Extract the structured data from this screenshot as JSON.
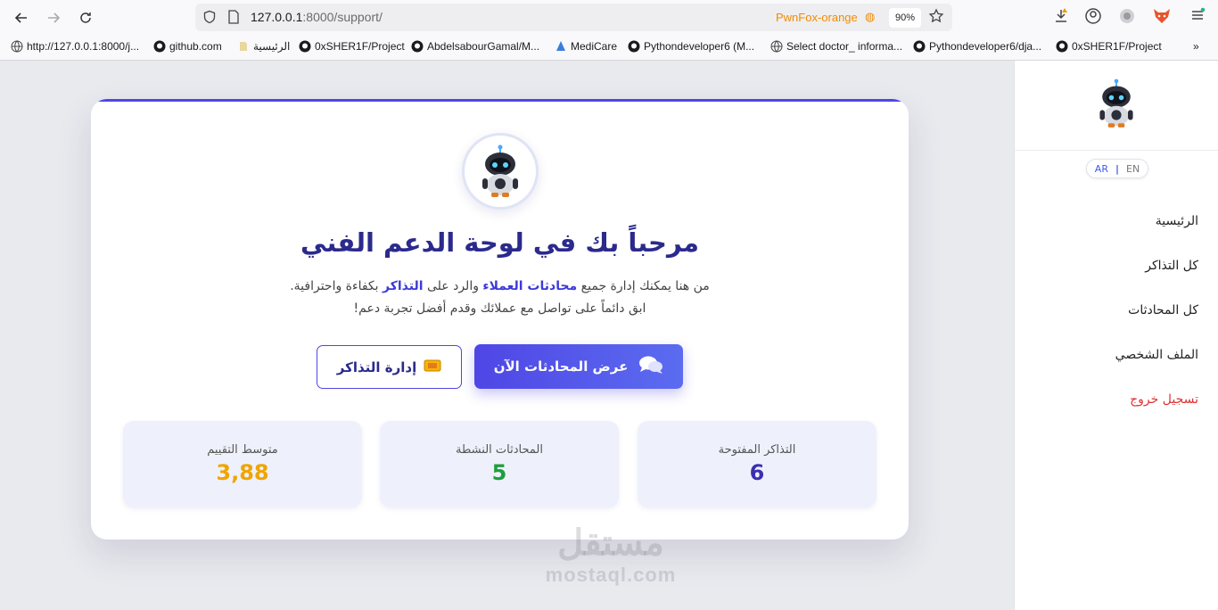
{
  "browser": {
    "url_host": "127.0.0.1",
    "url_rest": ":8000/support/",
    "container_label": "PwnFox-orange",
    "zoom": "90%",
    "bookmarks": [
      {
        "label": "http://127.0.0.1:8000/j...",
        "icon": "globe-icon"
      },
      {
        "label": "github.com",
        "icon": "github-icon"
      },
      {
        "label": "الرئيسية",
        "icon": "page-icon"
      },
      {
        "label": "0xSHER1F/Project",
        "icon": "github-icon"
      },
      {
        "label": "AbdelsabourGamal/M...",
        "icon": "github-icon"
      },
      {
        "label": "MediCare",
        "icon": "medicare-icon"
      },
      {
        "label": "Pythondeveloper6 (M...",
        "icon": "github-icon"
      },
      {
        "label": "Select doctor_ informa...",
        "icon": "globe-icon"
      },
      {
        "label": "Pythondeveloper6/dja...",
        "icon": "github-icon"
      },
      {
        "label": "0xSHER1F/Project",
        "icon": "github-icon"
      }
    ]
  },
  "sidebar": {
    "lang_ar": "AR",
    "lang_sep": "|",
    "lang_en": "EN",
    "items": [
      {
        "label": "الرئيسية"
      },
      {
        "label": "كل التذاكر"
      },
      {
        "label": "كل المحادثات"
      },
      {
        "label": "الملف الشخصي"
      },
      {
        "label": "تسجيل خروج"
      }
    ]
  },
  "main": {
    "title": "مرحباً بك في لوحة الدعم الفني",
    "subtitle_line1_a": "من هنا يمكنك إدارة جميع ",
    "subtitle_line1_hl1": "محادثات العملاء",
    "subtitle_line1_b": " والرد على ",
    "subtitle_line1_hl2": "التذاكر",
    "subtitle_line1_c": " بكفاءة واحترافية.",
    "subtitle_line2": "ابق دائماً على تواصل مع عملائك وقدم أفضل تجربة دعم!",
    "btn_chats": "عرض المحادثات الآن",
    "btn_tickets": "إدارة التذاكر",
    "stats": [
      {
        "label": "التذاكر المفتوحة",
        "value": "6",
        "color": "#3b2fb0"
      },
      {
        "label": "المحادثات النشطة",
        "value": "5",
        "color": "#1e9e3e"
      },
      {
        "label": "متوسط التقييم",
        "value": "3,88",
        "color": "#f0a500"
      }
    ]
  },
  "watermark": {
    "arabic": "مستقل",
    "latin": "mostaql.com"
  }
}
